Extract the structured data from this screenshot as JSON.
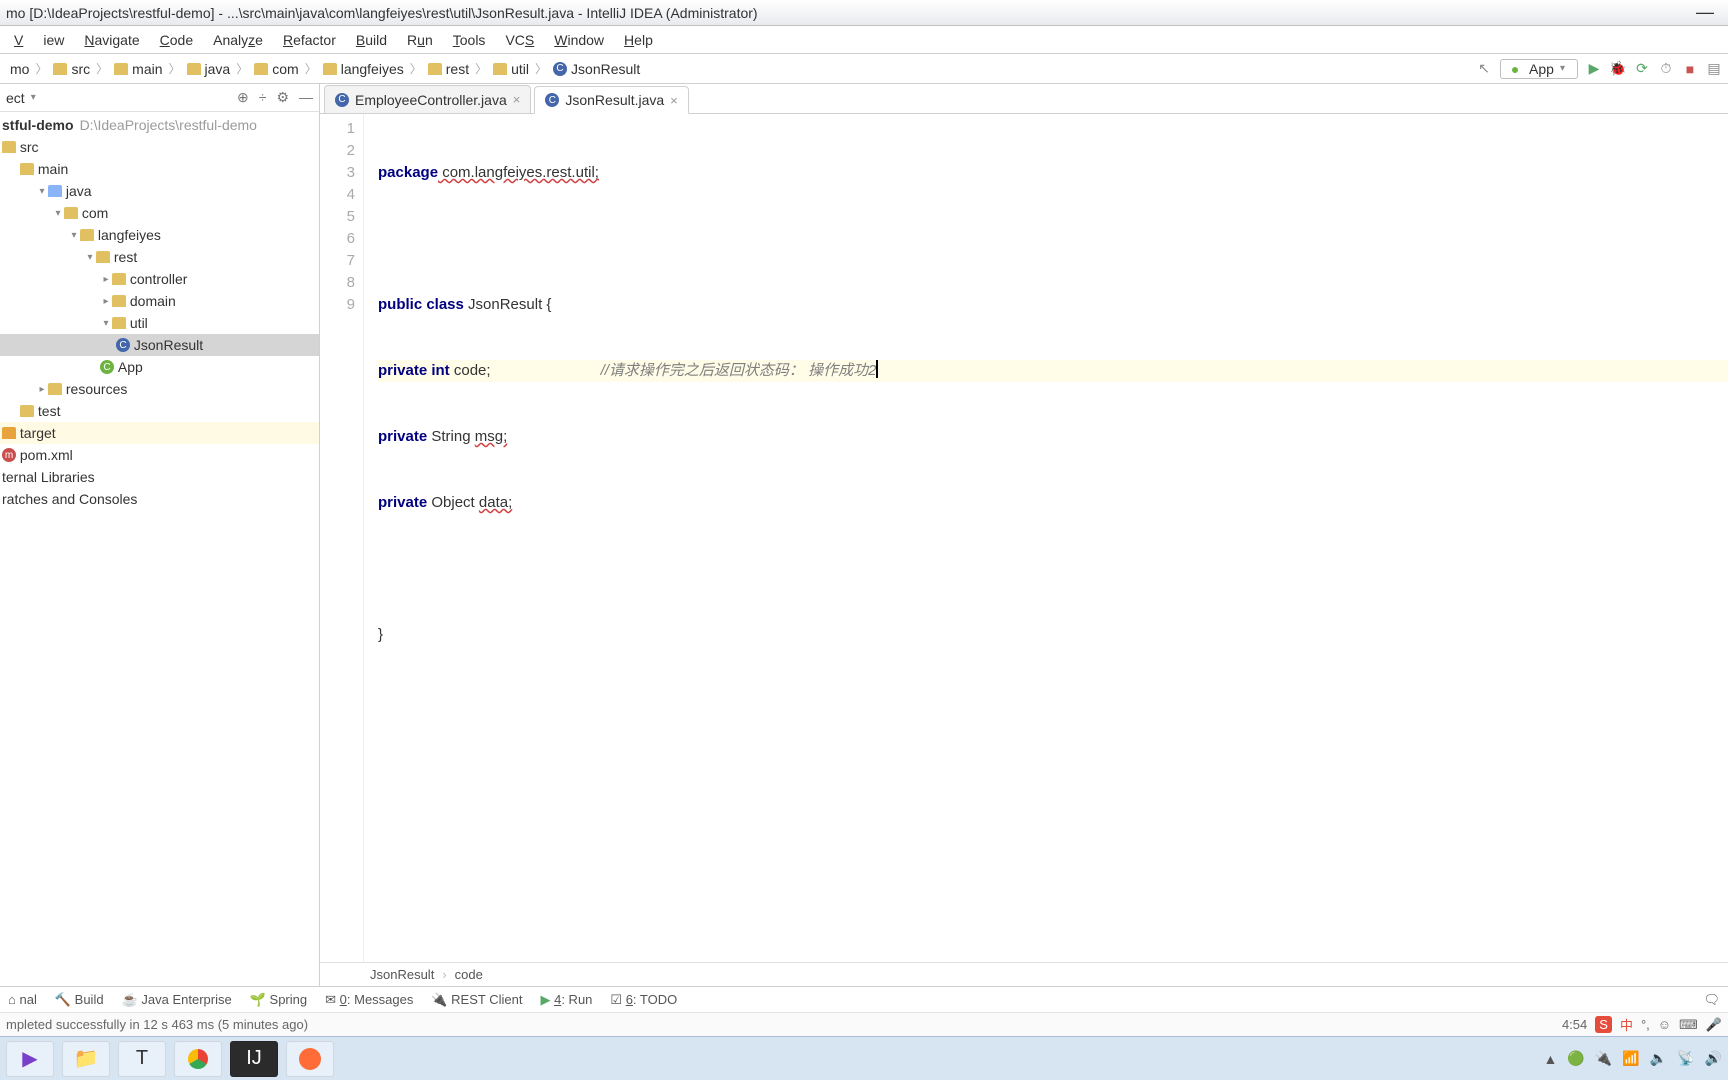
{
  "title": "mo [D:\\IdeaProjects\\restful-demo] - ...\\src\\main\\java\\com\\langfeiyes\\rest\\util\\JsonResult.java - IntelliJ IDEA (Administrator)",
  "menu": [
    "View",
    "Navigate",
    "Code",
    "Analyze",
    "Refactor",
    "Build",
    "Run",
    "Tools",
    "VCS",
    "Window",
    "Help"
  ],
  "breadcrumbs": [
    "mo",
    "src",
    "main",
    "java",
    "com",
    "langfeiyes",
    "rest",
    "util",
    "JsonResult"
  ],
  "run_config": "App",
  "sidebar_title": "ect",
  "tree": {
    "root": {
      "name": "stful-demo",
      "path": "D:\\IdeaProjects\\restful-demo"
    },
    "src": "src",
    "main": "main",
    "java": "java",
    "com": "com",
    "langfeiyes": "langfeiyes",
    "rest": "rest",
    "controller": "controller",
    "domain": "domain",
    "util": "util",
    "jsonresult": "JsonResult",
    "app": "App",
    "resources": "resources",
    "test": "test",
    "target": "target",
    "pom": "pom.xml",
    "ext": "ternal Libraries",
    "scratches": "ratches and Consoles"
  },
  "tabs": [
    {
      "name": "EmployeeController.java"
    },
    {
      "name": "JsonResult.java"
    }
  ],
  "code_lines": [
    "1",
    "2",
    "3",
    "4",
    "5",
    "6",
    "7",
    "8",
    "9"
  ],
  "code": {
    "l1_kw": "package",
    "l1_rest": " com.langfeiyes.rest.util;",
    "l3_kw1": "public class",
    "l3_cls": " JsonResult ",
    "l3_br": "{",
    "l4_kw": "private int",
    "l4_id": " code;",
    "l4_cm": "//请求操作完之后返回状态码： 操作成功2",
    "l5_kw": "private",
    "l5_ty": " String ",
    "l5_id": "msg;",
    "l6_kw": "private",
    "l6_ty": " Object ",
    "l6_id": "data;",
    "l8": "}"
  },
  "editor_crumb": {
    "cls": "JsonResult",
    "field": "code"
  },
  "bottom": [
    "nal",
    "Build",
    "Java Enterprise",
    "Spring",
    "0: Messages",
    "REST Client",
    "4: Run",
    "6: TODO"
  ],
  "bottom_icons": [
    "⌂",
    "🔨",
    "☕",
    "🌱",
    "✉",
    "🔌",
    "▶",
    "☑"
  ],
  "status_msg": "mpleted successfully in 12 s 463 ms (5 minutes ago)",
  "status_pos": "4:54",
  "tray": [
    "▲",
    "🟢",
    "🔌",
    "📶",
    "🔈",
    "📡",
    "🔊"
  ]
}
